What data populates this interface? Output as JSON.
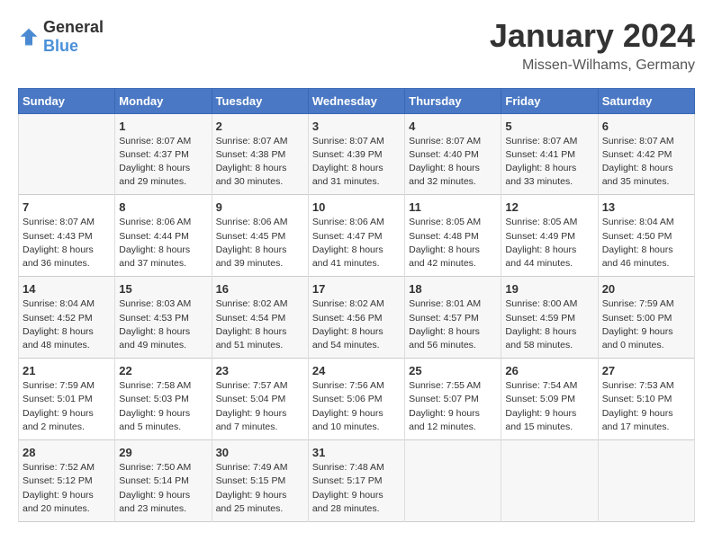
{
  "header": {
    "logo_general": "General",
    "logo_blue": "Blue",
    "month": "January 2024",
    "location": "Missen-Wilhams, Germany"
  },
  "weekdays": [
    "Sunday",
    "Monday",
    "Tuesday",
    "Wednesday",
    "Thursday",
    "Friday",
    "Saturday"
  ],
  "weeks": [
    [
      {
        "day": "",
        "sunrise": "",
        "sunset": "",
        "daylight": ""
      },
      {
        "day": "1",
        "sunrise": "Sunrise: 8:07 AM",
        "sunset": "Sunset: 4:37 PM",
        "daylight": "Daylight: 8 hours and 29 minutes."
      },
      {
        "day": "2",
        "sunrise": "Sunrise: 8:07 AM",
        "sunset": "Sunset: 4:38 PM",
        "daylight": "Daylight: 8 hours and 30 minutes."
      },
      {
        "day": "3",
        "sunrise": "Sunrise: 8:07 AM",
        "sunset": "Sunset: 4:39 PM",
        "daylight": "Daylight: 8 hours and 31 minutes."
      },
      {
        "day": "4",
        "sunrise": "Sunrise: 8:07 AM",
        "sunset": "Sunset: 4:40 PM",
        "daylight": "Daylight: 8 hours and 32 minutes."
      },
      {
        "day": "5",
        "sunrise": "Sunrise: 8:07 AM",
        "sunset": "Sunset: 4:41 PM",
        "daylight": "Daylight: 8 hours and 33 minutes."
      },
      {
        "day": "6",
        "sunrise": "Sunrise: 8:07 AM",
        "sunset": "Sunset: 4:42 PM",
        "daylight": "Daylight: 8 hours and 35 minutes."
      }
    ],
    [
      {
        "day": "7",
        "sunrise": "Sunrise: 8:07 AM",
        "sunset": "Sunset: 4:43 PM",
        "daylight": "Daylight: 8 hours and 36 minutes."
      },
      {
        "day": "8",
        "sunrise": "Sunrise: 8:06 AM",
        "sunset": "Sunset: 4:44 PM",
        "daylight": "Daylight: 8 hours and 37 minutes."
      },
      {
        "day": "9",
        "sunrise": "Sunrise: 8:06 AM",
        "sunset": "Sunset: 4:45 PM",
        "daylight": "Daylight: 8 hours and 39 minutes."
      },
      {
        "day": "10",
        "sunrise": "Sunrise: 8:06 AM",
        "sunset": "Sunset: 4:47 PM",
        "daylight": "Daylight: 8 hours and 41 minutes."
      },
      {
        "day": "11",
        "sunrise": "Sunrise: 8:05 AM",
        "sunset": "Sunset: 4:48 PM",
        "daylight": "Daylight: 8 hours and 42 minutes."
      },
      {
        "day": "12",
        "sunrise": "Sunrise: 8:05 AM",
        "sunset": "Sunset: 4:49 PM",
        "daylight": "Daylight: 8 hours and 44 minutes."
      },
      {
        "day": "13",
        "sunrise": "Sunrise: 8:04 AM",
        "sunset": "Sunset: 4:50 PM",
        "daylight": "Daylight: 8 hours and 46 minutes."
      }
    ],
    [
      {
        "day": "14",
        "sunrise": "Sunrise: 8:04 AM",
        "sunset": "Sunset: 4:52 PM",
        "daylight": "Daylight: 8 hours and 48 minutes."
      },
      {
        "day": "15",
        "sunrise": "Sunrise: 8:03 AM",
        "sunset": "Sunset: 4:53 PM",
        "daylight": "Daylight: 8 hours and 49 minutes."
      },
      {
        "day": "16",
        "sunrise": "Sunrise: 8:02 AM",
        "sunset": "Sunset: 4:54 PM",
        "daylight": "Daylight: 8 hours and 51 minutes."
      },
      {
        "day": "17",
        "sunrise": "Sunrise: 8:02 AM",
        "sunset": "Sunset: 4:56 PM",
        "daylight": "Daylight: 8 hours and 54 minutes."
      },
      {
        "day": "18",
        "sunrise": "Sunrise: 8:01 AM",
        "sunset": "Sunset: 4:57 PM",
        "daylight": "Daylight: 8 hours and 56 minutes."
      },
      {
        "day": "19",
        "sunrise": "Sunrise: 8:00 AM",
        "sunset": "Sunset: 4:59 PM",
        "daylight": "Daylight: 8 hours and 58 minutes."
      },
      {
        "day": "20",
        "sunrise": "Sunrise: 7:59 AM",
        "sunset": "Sunset: 5:00 PM",
        "daylight": "Daylight: 9 hours and 0 minutes."
      }
    ],
    [
      {
        "day": "21",
        "sunrise": "Sunrise: 7:59 AM",
        "sunset": "Sunset: 5:01 PM",
        "daylight": "Daylight: 9 hours and 2 minutes."
      },
      {
        "day": "22",
        "sunrise": "Sunrise: 7:58 AM",
        "sunset": "Sunset: 5:03 PM",
        "daylight": "Daylight: 9 hours and 5 minutes."
      },
      {
        "day": "23",
        "sunrise": "Sunrise: 7:57 AM",
        "sunset": "Sunset: 5:04 PM",
        "daylight": "Daylight: 9 hours and 7 minutes."
      },
      {
        "day": "24",
        "sunrise": "Sunrise: 7:56 AM",
        "sunset": "Sunset: 5:06 PM",
        "daylight": "Daylight: 9 hours and 10 minutes."
      },
      {
        "day": "25",
        "sunrise": "Sunrise: 7:55 AM",
        "sunset": "Sunset: 5:07 PM",
        "daylight": "Daylight: 9 hours and 12 minutes."
      },
      {
        "day": "26",
        "sunrise": "Sunrise: 7:54 AM",
        "sunset": "Sunset: 5:09 PM",
        "daylight": "Daylight: 9 hours and 15 minutes."
      },
      {
        "day": "27",
        "sunrise": "Sunrise: 7:53 AM",
        "sunset": "Sunset: 5:10 PM",
        "daylight": "Daylight: 9 hours and 17 minutes."
      }
    ],
    [
      {
        "day": "28",
        "sunrise": "Sunrise: 7:52 AM",
        "sunset": "Sunset: 5:12 PM",
        "daylight": "Daylight: 9 hours and 20 minutes."
      },
      {
        "day": "29",
        "sunrise": "Sunrise: 7:50 AM",
        "sunset": "Sunset: 5:14 PM",
        "daylight": "Daylight: 9 hours and 23 minutes."
      },
      {
        "day": "30",
        "sunrise": "Sunrise: 7:49 AM",
        "sunset": "Sunset: 5:15 PM",
        "daylight": "Daylight: 9 hours and 25 minutes."
      },
      {
        "day": "31",
        "sunrise": "Sunrise: 7:48 AM",
        "sunset": "Sunset: 5:17 PM",
        "daylight": "Daylight: 9 hours and 28 minutes."
      },
      {
        "day": "",
        "sunrise": "",
        "sunset": "",
        "daylight": ""
      },
      {
        "day": "",
        "sunrise": "",
        "sunset": "",
        "daylight": ""
      },
      {
        "day": "",
        "sunrise": "",
        "sunset": "",
        "daylight": ""
      }
    ]
  ]
}
